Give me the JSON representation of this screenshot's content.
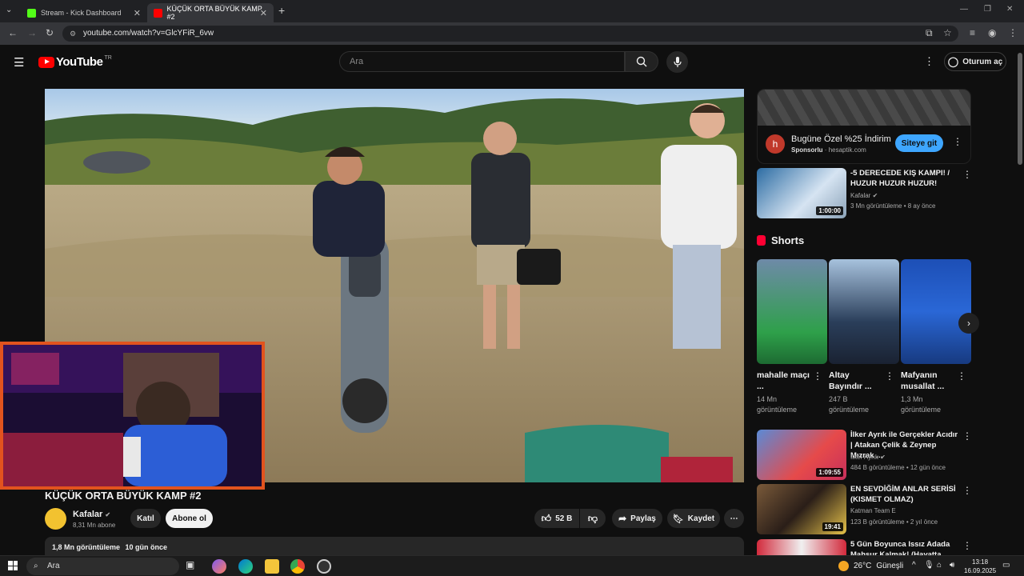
{
  "browser": {
    "tabs": [
      {
        "title": "Stream - Kick Dashboard",
        "favicon": "kick-icon",
        "color": "#53fc18"
      },
      {
        "title": "KÜÇÜK ORTA BÜYÜK KAMP #2",
        "favicon": "youtube-icon",
        "color": "#ff0000"
      }
    ],
    "url": "youtube.com/watch?v=GlcYFiR_6vw"
  },
  "youtube": {
    "logo_text": "YouTube",
    "region": "TR",
    "search_placeholder": "Ara",
    "signin_label": "Oturum aç"
  },
  "video": {
    "title": "KÜÇÜK ORTA BÜYÜK KAMP #2",
    "channel": "Kafalar",
    "subscribers": "8,31 Mn abone",
    "join_label": "Katıl",
    "subscribe_label": "Abone ol",
    "likes": "52 B",
    "share_label": "Paylaş",
    "save_label": "Kaydet",
    "views": "1,8 Mn görüntüleme",
    "age": "10 gün önce"
  },
  "ad": {
    "logo_letter": "h",
    "title": "Bugüne Özel %25 İndirim",
    "sponsored": "Sponsorlu",
    "domain": "hesaptik.com",
    "cta": "Siteye git"
  },
  "recommendations": [
    {
      "title": "-5 DERECEDE KIŞ KAMPI! / HUZUR HUZUR HUZUR!",
      "channel": "Kafalar",
      "views": "3 Mn görüntüleme",
      "age": "8 ay önce",
      "duration": "1:00:00"
    },
    {
      "title": "İlker Ayrık ile Gerçekler Acıdır | Atakan Çelik & Zeynep Mızrak ...",
      "channel": "İlker Ayrık",
      "views": "484 B görüntüleme",
      "age": "12 gün önce",
      "duration": "1:09:55"
    },
    {
      "title": "EN SEVDİĞİM ANLAR SERİSİ (KISMET OLMAZ)",
      "channel": "Katman Team E",
      "views": "123 B görüntüleme",
      "age": "2 yıl önce",
      "duration": "19:41"
    },
    {
      "title": "5 Gün Boyunca Issız Adada Mahsur Kalmak! (Hayatta Kal..."
    }
  ],
  "shorts": {
    "heading": "Shorts",
    "items": [
      {
        "title": "mahalle maçı ...",
        "views": "14 Mn",
        "views_suffix": "görüntüleme"
      },
      {
        "title": "Altay Bayındır ...",
        "views": "247 B",
        "views_suffix": "görüntüleme"
      },
      {
        "title": "Mafyanın musallat ...",
        "views": "1,3 Mn",
        "views_suffix": "görüntüleme"
      }
    ]
  },
  "taskbar": {
    "search_placeholder": "Ara",
    "weather": "26°C",
    "weather_desc": "Güneşli",
    "time": "13:18",
    "date": "16.09.2025"
  }
}
